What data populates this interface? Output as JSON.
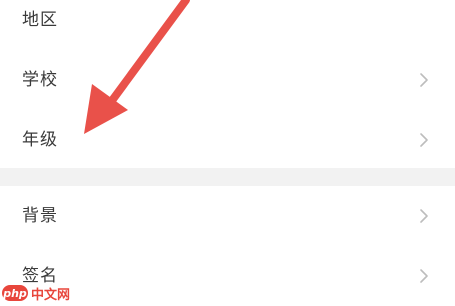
{
  "settings": {
    "items": [
      {
        "label": "地区"
      },
      {
        "label": "学校"
      },
      {
        "label": "年级"
      },
      {
        "label": "背景"
      },
      {
        "label": "签名"
      }
    ]
  },
  "watermark": {
    "badge": "php",
    "text": "中文网"
  },
  "colors": {
    "arrow": "#e9514a",
    "separator": "#f2f2f2",
    "text": "#3a3a3a",
    "chevron": "#bdbdbd"
  }
}
